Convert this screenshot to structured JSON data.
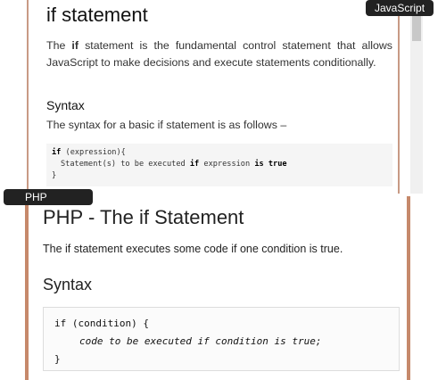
{
  "labels": {
    "top": "JavaScript",
    "bottom": "PHP"
  },
  "javascript": {
    "title": "if statement",
    "para_pre": "The ",
    "para_bold": "if",
    "para_post": " statement is the fundamental control statement that allows JavaScript to make decisions and execute statements conditionally.",
    "syntax_heading": "Syntax",
    "syntax_desc": "The syntax for a basic if statement is as follows –",
    "code": {
      "l1_kw": "if",
      "l1_rest": " (expression){",
      "l2_a": "Statement(s) to be executed ",
      "l2_kw1": "if",
      "l2_b": " expression ",
      "l2_kw2": "is",
      "l2_c": " ",
      "l2_kw3": "true",
      "l3": "}"
    }
  },
  "php": {
    "title": "PHP - The if Statement",
    "para": "The if statement executes some code if one condition is true.",
    "syntax_heading": "Syntax",
    "code": {
      "l1": "if (condition) {",
      "l2": "code to be executed if condition is true;",
      "l3": "}"
    }
  },
  "colors": {
    "label_bg": "#222222",
    "panel_border": "#c6896b"
  }
}
